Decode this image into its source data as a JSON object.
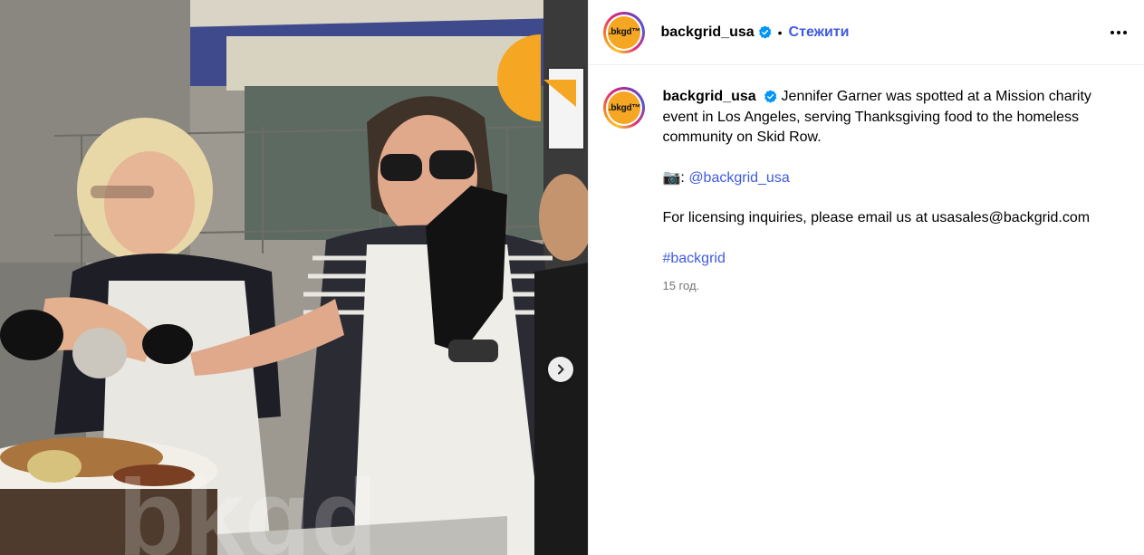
{
  "post": {
    "username": "backgrid_usa",
    "avatar_text": ".bkgd™",
    "follow_label": "Стежити",
    "separator": "•",
    "caption": {
      "text_1": "Jennifer Garner was spotted at a Mission charity event in Los Angeles, serving Thanksgiving food to the homeless community on Skid Row.",
      "camera_emoji": "📷",
      "credit_prefix": ":",
      "credit_handle": "@backgrid_usa",
      "licensing": "For licensing inquiries, please email us at usasales@backgrid.com",
      "hashtag": "#backgrid"
    },
    "time_ago": "15 год.",
    "watermark": "bkgd"
  },
  "colors": {
    "link": "#3f5ae0",
    "verified": "#0095f6",
    "brand_orange": "#f5a623",
    "muted": "#737373"
  },
  "icons": [
    "verified-badge-icon",
    "more-options-icon",
    "chevron-right-icon",
    "camera-icon"
  ]
}
